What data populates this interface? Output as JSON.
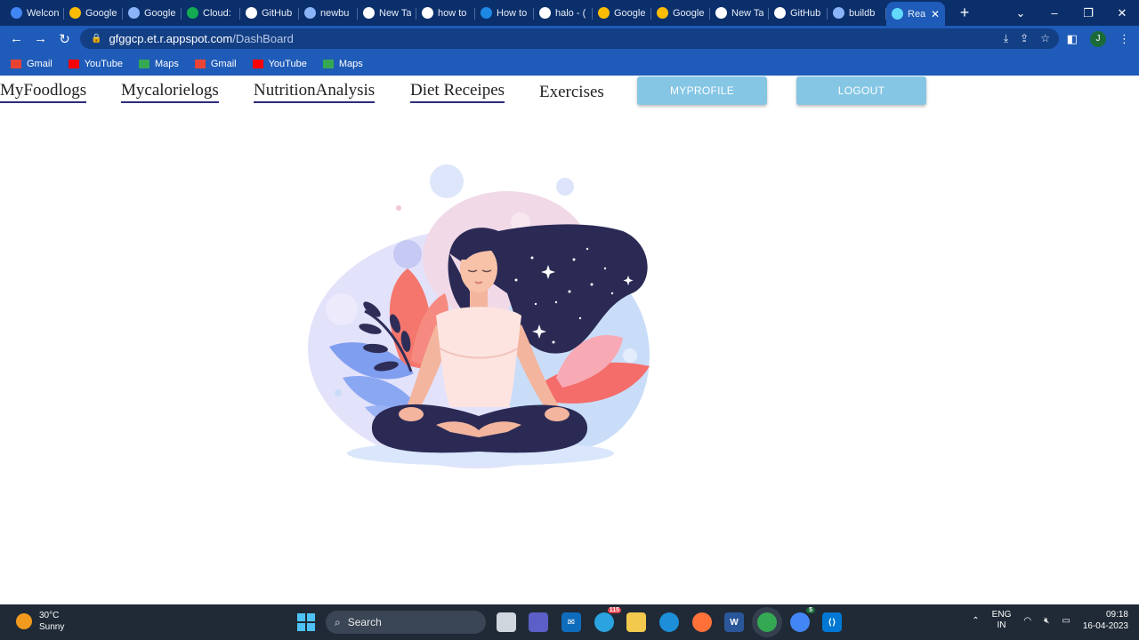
{
  "browser": {
    "tabs": [
      {
        "label": "Welcon",
        "icon": "drive-icon",
        "color": "#4285f4"
      },
      {
        "label": "Google",
        "icon": "google-cloud-icon",
        "color": "#fbbc05"
      },
      {
        "label": "Google",
        "icon": "api-icon",
        "color": "#8ab4f8"
      },
      {
        "label": "Cloud:",
        "icon": "mongodb-icon",
        "color": "#13aa52"
      },
      {
        "label": "GitHub",
        "icon": "github-icon",
        "color": "#ffffff"
      },
      {
        "label": "newbu",
        "icon": "board-icon",
        "color": "#8ab4f8"
      },
      {
        "label": "New Ta",
        "icon": "chrome-icon",
        "color": "#ffffff"
      },
      {
        "label": "how to",
        "icon": "google-icon",
        "color": "#ffffff"
      },
      {
        "label": "How to",
        "icon": "cd-icon",
        "color": "#1e88e5"
      },
      {
        "label": "halo - (",
        "icon": "google-icon",
        "color": "#ffffff"
      },
      {
        "label": "Google",
        "icon": "google-cloud-icon",
        "color": "#fbbc05"
      },
      {
        "label": "Google",
        "icon": "google-cloud-icon",
        "color": "#fbbc05"
      },
      {
        "label": "New Ta",
        "icon": "chrome-icon",
        "color": "#ffffff"
      },
      {
        "label": "GitHub",
        "icon": "github-icon",
        "color": "#ffffff"
      },
      {
        "label": "buildb",
        "icon": "board-icon",
        "color": "#8ab4f8"
      },
      {
        "label": "Rea",
        "icon": "react-icon",
        "color": "#61dafb",
        "active": true
      }
    ],
    "url_host": "gfggcp.et.r.appspot.com",
    "url_path": "/DashBoard",
    "profile_initial": "J",
    "bookmarks": [
      {
        "label": "Gmail",
        "icon": "gmail-icon",
        "color": "#ea4335"
      },
      {
        "label": "YouTube",
        "icon": "youtube-icon",
        "color": "#ff0000"
      },
      {
        "label": "Maps",
        "icon": "maps-icon",
        "color": "#34a853"
      },
      {
        "label": "Gmail",
        "icon": "gmail-icon",
        "color": "#ea4335"
      },
      {
        "label": "YouTube",
        "icon": "youtube-icon",
        "color": "#ff0000"
      },
      {
        "label": "Maps",
        "icon": "maps-icon",
        "color": "#34a853"
      }
    ]
  },
  "app": {
    "nav": {
      "myfoodlogs": "MyFoodlogs",
      "mycalorielogs": "Mycalorielogs",
      "nutrition": "NutritionAnalysis",
      "diet": "Diet Receipes",
      "exercises": "Exercises",
      "myprofile": "MYPROFILE",
      "logout": "LOGOUT"
    },
    "accent": "#85c6e4"
  },
  "taskbar": {
    "weather_temp": "30°C",
    "weather_desc": "Sunny",
    "search_placeholder": "Search",
    "lang_top": "ENG",
    "lang_bottom": "IN",
    "time": "09:18",
    "date": "16-04-2023",
    "telegram_badge": "115",
    "chrome_badge": "5"
  }
}
